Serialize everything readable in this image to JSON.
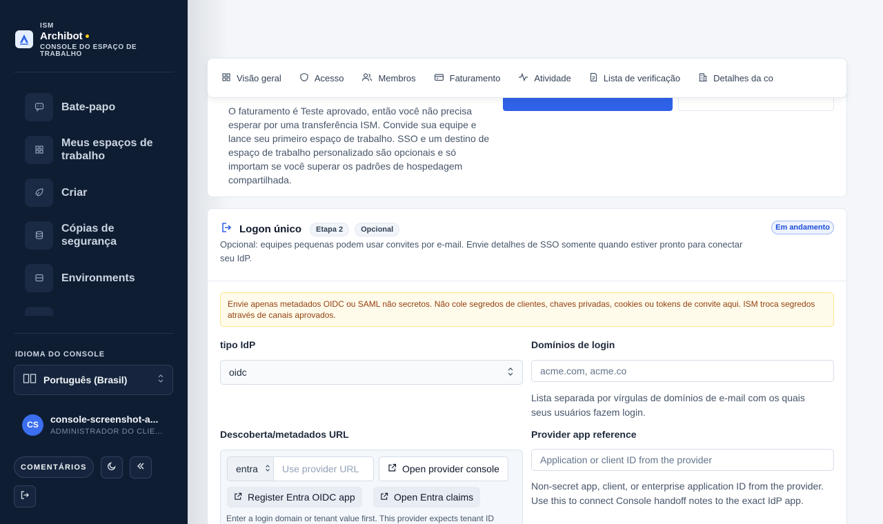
{
  "brand": {
    "eyebrow": "ISM",
    "name": "Archibot",
    "subtitle": "CONSOLE DO ESPAÇO DE TRABALHO",
    "dot_color": "#facc15"
  },
  "nav": {
    "items": [
      {
        "label": "Bate-papo",
        "icon": "chat-icon"
      },
      {
        "label": "Meus espaços de trabalho",
        "icon": "grid-icon"
      },
      {
        "label": "Criar",
        "icon": "rocket-icon"
      },
      {
        "label": "Cópias de segurança",
        "icon": "database-icon"
      },
      {
        "label": "Environments",
        "icon": "server-icon"
      }
    ]
  },
  "language": {
    "title": "IDIOMA DO CONSOLE",
    "selected": "Português (Brasil)"
  },
  "user": {
    "initials": "CS",
    "name": "console-screenshot-a...",
    "role": "ADMINISTRADOR DO CLIE..."
  },
  "footer": {
    "feedback_label": "COMENTÁRIOS"
  },
  "tabs": [
    {
      "label": "Visão geral",
      "icon": "overview-icon"
    },
    {
      "label": "Acesso",
      "icon": "shield-icon"
    },
    {
      "label": "Membros",
      "icon": "users-icon"
    },
    {
      "label": "Faturamento",
      "icon": "credit-card-icon"
    },
    {
      "label": "Atividade",
      "icon": "activity-icon"
    },
    {
      "label": "Lista de verificação",
      "icon": "checklist-icon"
    },
    {
      "label": "Detalhes da co",
      "icon": "building-icon"
    }
  ],
  "billing_card": {
    "text": "O faturamento é Teste aprovado, então você não precisa esperar por uma transferência ISM. Convide sua equipe e lance seu primeiro espaço de trabalho. SSO e um destino de espaço de trabalho personalizado são opcionais e só importam se você superar os padrões de hospedagem compartilhada."
  },
  "sso": {
    "title": "Logon único",
    "step_chip": "Etapa 2",
    "optional_chip": "Opcional",
    "status": "Em andamento",
    "description": "Opcional: equipes pequenas podem usar convites por e-mail. Envie detalhes de SSO somente quando estiver pronto para conectar seu IdP.",
    "warning": "Envie apenas metadados OIDC ou SAML não secretos. Não cole segredos de clientes, chaves privadas, cookies ou tokens de convite aqui. ISM troca segredos através de canais aprovados.",
    "idp_type": {
      "label": "tipo IdP",
      "value": "oidc"
    },
    "login_domains": {
      "label": "Domínios de login",
      "placeholder": "acme.com, acme.co",
      "help": "Lista separada por vírgulas de domínios de e-mail com os quais seus usuários fazem login."
    },
    "discovery": {
      "label": "Descoberta/metadados URL",
      "provider": "entra",
      "url_placeholder": "Use provider URL",
      "open_console": "Open provider console",
      "register_app": "Register Entra OIDC app",
      "open_claims": "Open Entra claims",
      "hint": "Enter a login domain or tenant value first. This provider expects tenant ID"
    },
    "provider_app": {
      "label": "Provider app reference",
      "placeholder": "Application or client ID from the provider",
      "help": "Non-secret app, client, or enterprise application ID from the provider. Use this to connect Console handoff notes to the exact IdP app."
    }
  },
  "colors": {
    "sidebar_bg": "#0f1d33",
    "primary": "#2f62e8",
    "status_blue": "#1d4ed8",
    "warning_text": "#92400e"
  }
}
